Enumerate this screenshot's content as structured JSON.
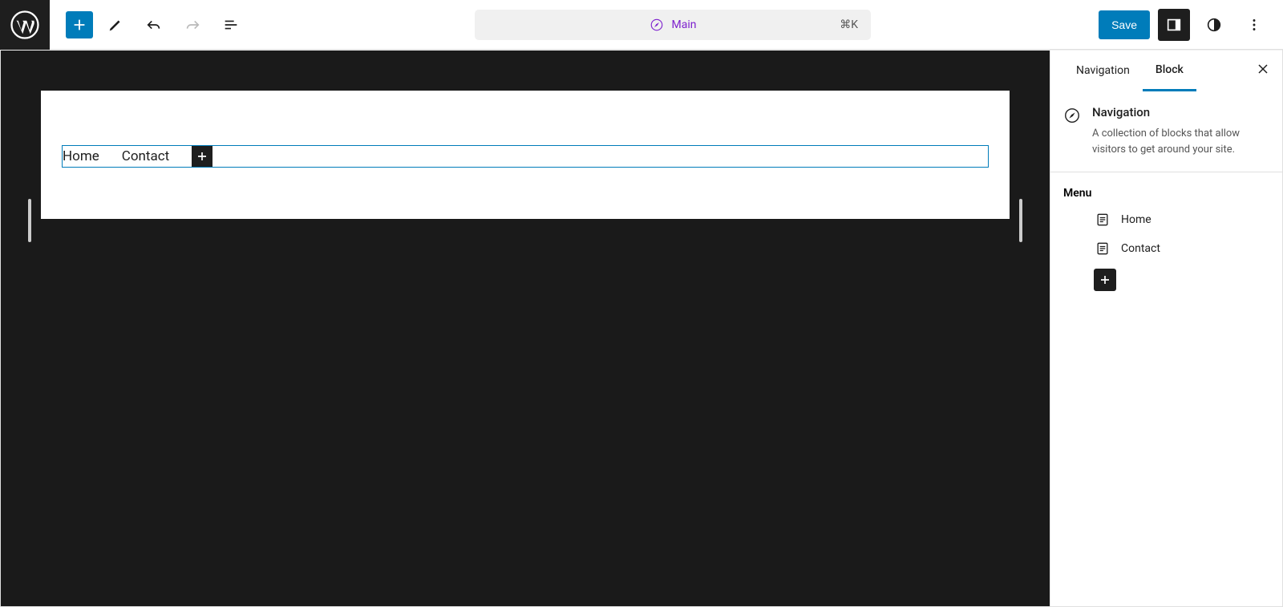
{
  "topbar": {
    "document_label": "Main",
    "shortcut": "⌘K",
    "save_label": "Save"
  },
  "canvas": {
    "nav_items": [
      "Home",
      "Contact"
    ]
  },
  "inspector": {
    "tabs": {
      "navigation": "Navigation",
      "block": "Block"
    },
    "header": {
      "title": "Navigation",
      "description": "A collection of blocks that allow visitors to get around your site."
    },
    "menu": {
      "heading": "Menu",
      "items": [
        "Home",
        "Contact"
      ]
    }
  }
}
